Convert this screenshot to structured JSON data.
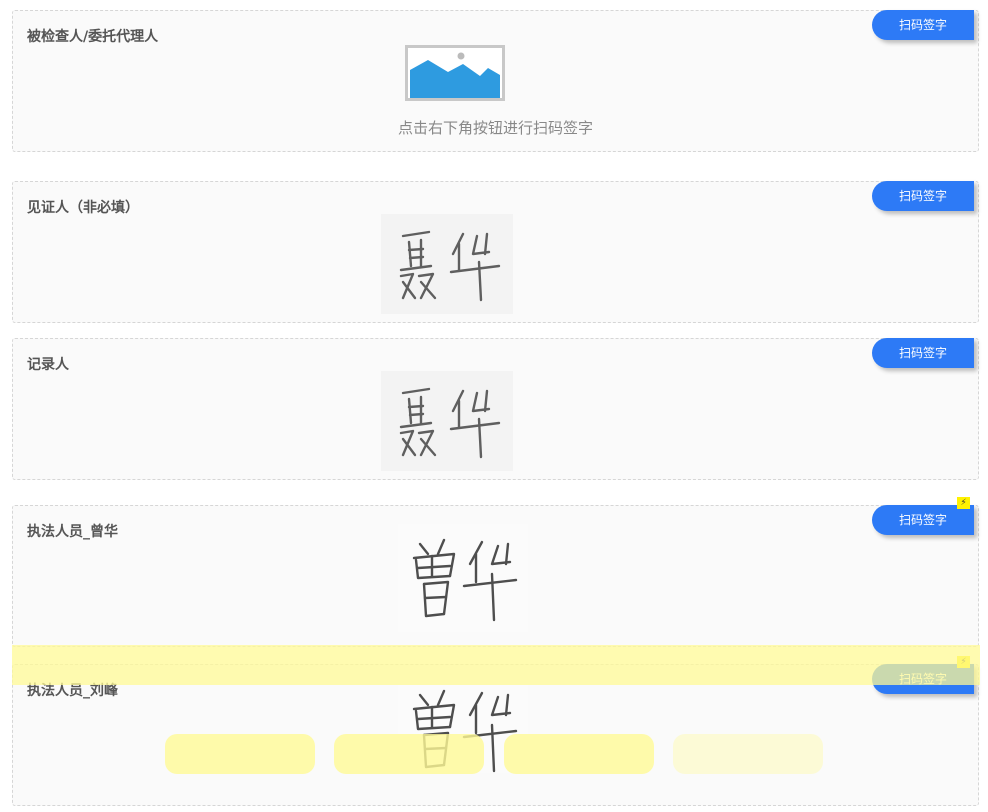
{
  "scan_button_label": "扫码签字",
  "bolt_glyph": "⚡",
  "accent_color": "#2d7af6",
  "sections": [
    {
      "title": "被检查人/委托代理人",
      "hint": "点击右下角按钮进行扫码签字"
    },
    {
      "title": "见证人（非必填）"
    },
    {
      "title": "记录人"
    },
    {
      "title": "执法人员_曾华"
    },
    {
      "title": "执法人员_刘峰"
    }
  ],
  "icons": {
    "placeholder": "image-placeholder-icon",
    "signature": "handwritten-signature-image",
    "bolt": "lightning-bolt-icon"
  }
}
